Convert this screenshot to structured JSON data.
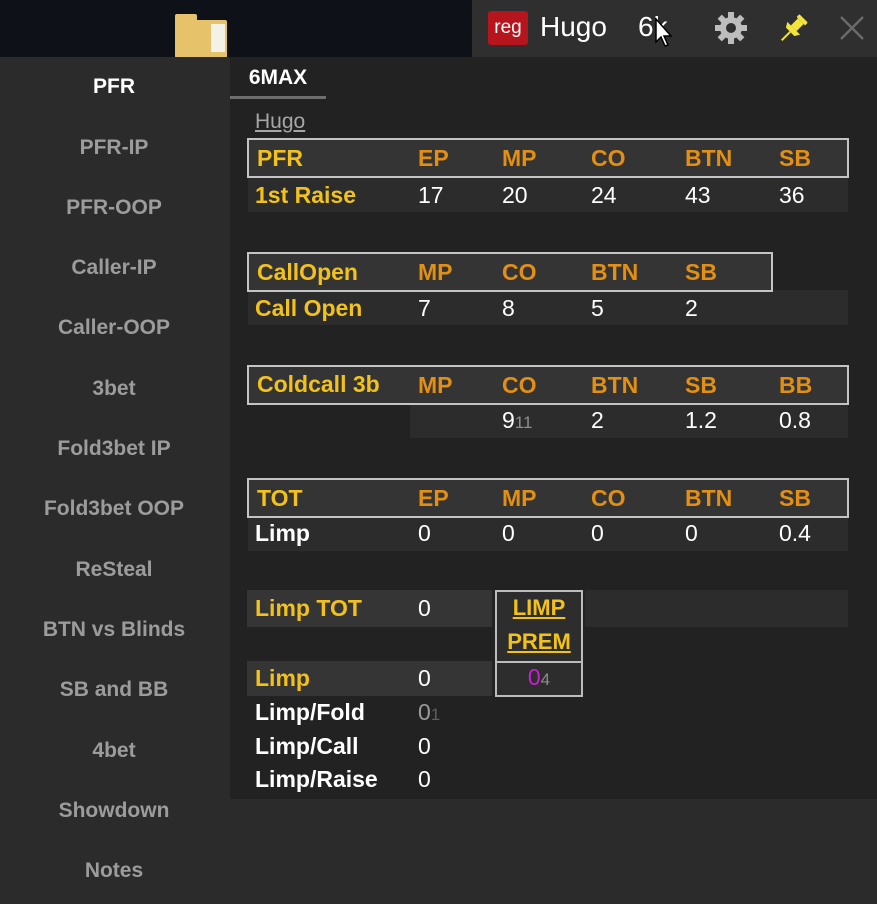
{
  "header": {
    "badge": "reg",
    "player_name": "Hugo",
    "hands": "6k"
  },
  "icons": [
    "folder-icon",
    "gear-icon",
    "pin-icon",
    "close-icon",
    "cursor-icon"
  ],
  "colors": {
    "badge_red": "#b7151e",
    "stat_yellow": "#f2c21a",
    "position_orange": "#e38f12",
    "pin_yellow": "#f1e43a",
    "value_purple": "#c81fd2"
  },
  "sidebar": {
    "items": [
      {
        "label": "PFR",
        "active": true
      },
      {
        "label": "PFR-IP"
      },
      {
        "label": "PFR-OOP"
      },
      {
        "label": "Caller-IP"
      },
      {
        "label": "Caller-OOP"
      },
      {
        "label": "3bet"
      },
      {
        "label": "Fold3bet IP"
      },
      {
        "label": "Fold3bet OOP"
      },
      {
        "label": "ReSteal"
      },
      {
        "label": "BTN vs Blinds"
      },
      {
        "label": "SB and BB"
      },
      {
        "label": "4bet"
      },
      {
        "label": "Showdown"
      },
      {
        "label": "Notes"
      }
    ]
  },
  "main": {
    "tab": "6MAX",
    "player_link": "Hugo",
    "pfr": {
      "title": "PFR",
      "headers": [
        "EP",
        "MP",
        "CO",
        "BTN",
        "SB"
      ],
      "row_label": "1st Raise",
      "values": [
        "17",
        "20",
        "24",
        "43",
        "36"
      ]
    },
    "callopen": {
      "title": "CallOpen",
      "headers": [
        "MP",
        "CO",
        "BTN",
        "SB"
      ],
      "row_label": "Call Open",
      "values": [
        "7",
        "8",
        "5",
        "2"
      ]
    },
    "coldcall": {
      "title": "Coldcall 3b",
      "headers": [
        "MP",
        "CO",
        "BTN",
        "SB",
        "BB"
      ],
      "co_value": "9",
      "co_sample": "11",
      "values": [
        "2",
        "1.2",
        "0.8"
      ]
    },
    "tot": {
      "title": "TOT",
      "headers": [
        "EP",
        "MP",
        "CO",
        "BTN",
        "SB"
      ],
      "row_label": "Limp",
      "values": [
        "0",
        "0",
        "0",
        "0",
        "0.4"
      ]
    },
    "limp_tot": {
      "label": "Limp TOT",
      "value": "0"
    },
    "limp_rows": [
      {
        "label": "Limp",
        "value": "0"
      },
      {
        "label": "Limp/Fold",
        "value": "0",
        "sample": "1"
      },
      {
        "label": "Limp/Call",
        "value": "0"
      },
      {
        "label": "Limp/Raise",
        "value": "0"
      }
    ],
    "limp_prem": {
      "line1": "LIMP",
      "line2": "PREM",
      "value": "0",
      "sample": "4"
    }
  }
}
